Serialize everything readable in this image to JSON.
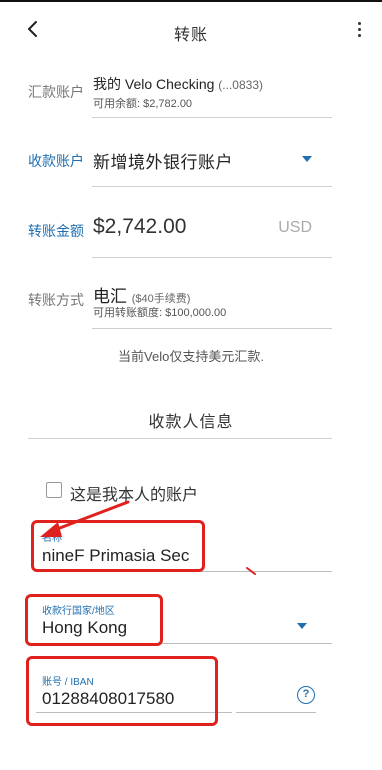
{
  "header": {
    "title": "转账"
  },
  "from": {
    "label": "汇款账户",
    "account_name": "我的 Velo Checking",
    "account_suffix": "(...0833)",
    "balance": "可用余额: $2,782.00"
  },
  "to": {
    "label": "收款账户",
    "value": "新增境外银行账户"
  },
  "amount": {
    "label": "转账金额",
    "value": "$2,742.00",
    "currency": "USD"
  },
  "method": {
    "label": "转账方式",
    "value": "电汇",
    "fee": "($40手续费)",
    "limit": "可用转账额度: $100,000.00"
  },
  "note": "当前Velo仅支持美元汇款.",
  "payee": {
    "section_title": "收款人信息",
    "own_account_label": "这是我本人的账户",
    "name_label": "名称",
    "name_value": "nineF Primasia Sec",
    "country_label": "收款行国家/地区",
    "country_value": "Hong Kong",
    "account_label": "账号 / IBAN",
    "account_value": "01288408017580",
    "help_glyph": "?"
  },
  "colors": {
    "accent": "#1f6fb0",
    "annotation": "#e0221e"
  },
  "icons": [
    "back-arrow-icon",
    "more-vertical-icon",
    "dropdown-arrow-icon",
    "help-icon"
  ]
}
